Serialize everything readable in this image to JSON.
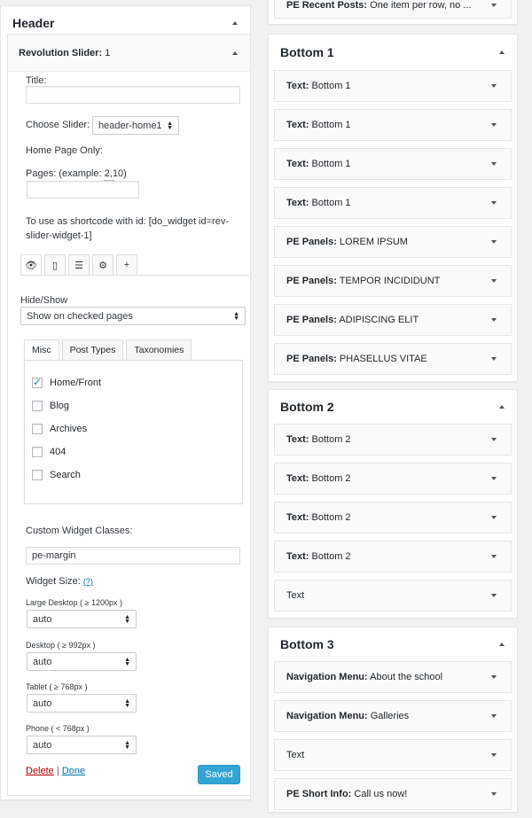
{
  "header_sidebar": {
    "title": "Header",
    "widget": {
      "type": "Revolution Slider:",
      "name": "1",
      "title_label": "Title:",
      "title_value": "",
      "choose_slider_label": "Choose Slider:",
      "choose_slider_value": "header-home1",
      "home_only_label": "Home Page Only:",
      "pages_label": "Pages: (example: 2,10)",
      "pages_value": "",
      "shortcode_text": "To use as shortcode with id: [do_widget id=rev-slider-widget-1]",
      "tab_icons": [
        "eye-icon",
        "mobile-icon",
        "align-center-icon",
        "gear-icon",
        "plus-icon"
      ],
      "hide_show_label": "Hide/Show",
      "hide_show_value": "Show on checked pages",
      "page_tabs": [
        "Misc",
        "Post Types",
        "Taxonomies"
      ],
      "misc_items": [
        {
          "label": "Home/Front",
          "checked": true
        },
        {
          "label": "Blog",
          "checked": false
        },
        {
          "label": "Archives",
          "checked": false
        },
        {
          "label": "404",
          "checked": false
        },
        {
          "label": "Search",
          "checked": false
        }
      ],
      "classes_label": "Custom Widget Classes:",
      "classes_value": "pe-margin",
      "size_label": "Widget Size:",
      "size_help": "(?)",
      "sizes": [
        {
          "label": "Large Desktop ( ≥ 1200px )",
          "value": "auto"
        },
        {
          "label": "Desktop ( ≥ 992px )",
          "value": "auto"
        },
        {
          "label": "Tablet ( ≥ 768px )",
          "value": "auto"
        },
        {
          "label": "Phone ( < 768px )",
          "value": "auto"
        }
      ],
      "delete_label": "Delete",
      "separator": "|",
      "done_label": "Done",
      "saved_label": "Saved"
    }
  },
  "top_widget": {
    "type": "PE Recent Posts:",
    "name": "One item per row, no ..."
  },
  "bottom1": {
    "title": "Bottom 1",
    "widgets": [
      {
        "type": "Text:",
        "name": "Bottom 1"
      },
      {
        "type": "Text:",
        "name": "Bottom 1"
      },
      {
        "type": "Text:",
        "name": "Bottom 1"
      },
      {
        "type": "Text:",
        "name": "Bottom 1"
      },
      {
        "type": "PE Panels:",
        "name": "LOREM IPSUM"
      },
      {
        "type": "PE Panels:",
        "name": "TEMPOR INCIDIDUNT"
      },
      {
        "type": "PE Panels:",
        "name": "ADIPISCING ELIT"
      },
      {
        "type": "PE Panels:",
        "name": "PHASELLUS VITAE"
      }
    ]
  },
  "bottom2": {
    "title": "Bottom 2",
    "widgets": [
      {
        "type": "Text:",
        "name": "Bottom 2"
      },
      {
        "type": "Text:",
        "name": "Bottom 2"
      },
      {
        "type": "Text:",
        "name": "Bottom 2"
      },
      {
        "type": "Text:",
        "name": "Bottom 2"
      },
      {
        "type": "Text",
        "name": ""
      }
    ]
  },
  "bottom3": {
    "title": "Bottom 3",
    "widgets": [
      {
        "type": "Navigation Menu:",
        "name": "About the school"
      },
      {
        "type": "Navigation Menu:",
        "name": "Galleries"
      },
      {
        "type": "Text",
        "name": ""
      },
      {
        "type": "PE Short Info:",
        "name": "Call us now!"
      }
    ]
  }
}
